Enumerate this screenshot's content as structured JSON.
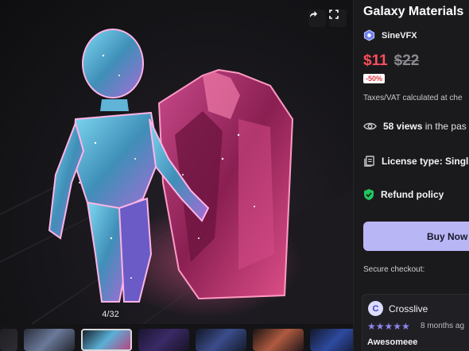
{
  "viewer": {
    "counter": "4/32",
    "share_icon": "share-icon",
    "fullscreen_icon": "fullscreen-icon"
  },
  "product": {
    "title": "Galaxy Materials",
    "seller": "SineVFX",
    "price": "$11",
    "old_price": "$22",
    "discount": "-50%",
    "tax_note": "Taxes/VAT calculated at che",
    "views_count": "58 views",
    "views_suffix": " in the pas",
    "license_label": "License type: Singl",
    "refund_label": "Refund policy",
    "buy_label": "Buy Now",
    "secure_label": "Secure checkout:"
  },
  "review": {
    "avatar_letter": "C",
    "reviewer": "Crosslive",
    "stars": "★★★★★",
    "rating": 5,
    "ago": "8 months ag",
    "title": "Awesomeee"
  },
  "colors": {
    "accent": "#b9b6f5",
    "price": "#ff4d5a",
    "refund_green": "#22c55e"
  }
}
